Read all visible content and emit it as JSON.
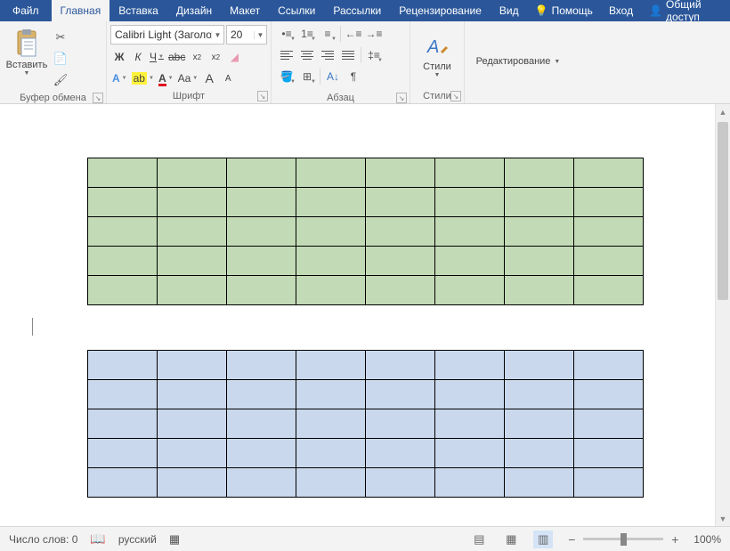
{
  "tabs": {
    "file": "Файл",
    "home": "Главная",
    "insert": "Вставка",
    "design": "Дизайн",
    "layout": "Макет",
    "references": "Ссылки",
    "mailings": "Рассылки",
    "review": "Рецензирование",
    "view": "Вид",
    "help_placeholder": "Помощь",
    "signin": "Вход",
    "share": "Общий доступ"
  },
  "ribbon": {
    "clipboard": {
      "label": "Буфер обмена",
      "paste": "Вставить"
    },
    "font": {
      "label": "Шрифт",
      "font_name": "Calibri Light (Заголовки)",
      "font_size": "20",
      "bold": "Ж",
      "italic": "К",
      "underline": "Ч",
      "strike": "abc",
      "sub": "x",
      "sup": "x",
      "aa": "Aa",
      "bigA": "A",
      "smallA": "A"
    },
    "paragraph": {
      "label": "Абзац"
    },
    "styles": {
      "label": "Стили",
      "button": "Стили"
    },
    "editing": {
      "label": " ",
      "button": "Редактирование"
    }
  },
  "document": {
    "table1": {
      "rows": 5,
      "cols": 8,
      "color": "green"
    },
    "table2": {
      "rows": 5,
      "cols": 8,
      "color": "blue"
    }
  },
  "status": {
    "word_count": "Число слов: 0",
    "language": "русский",
    "zoom": "100%"
  }
}
